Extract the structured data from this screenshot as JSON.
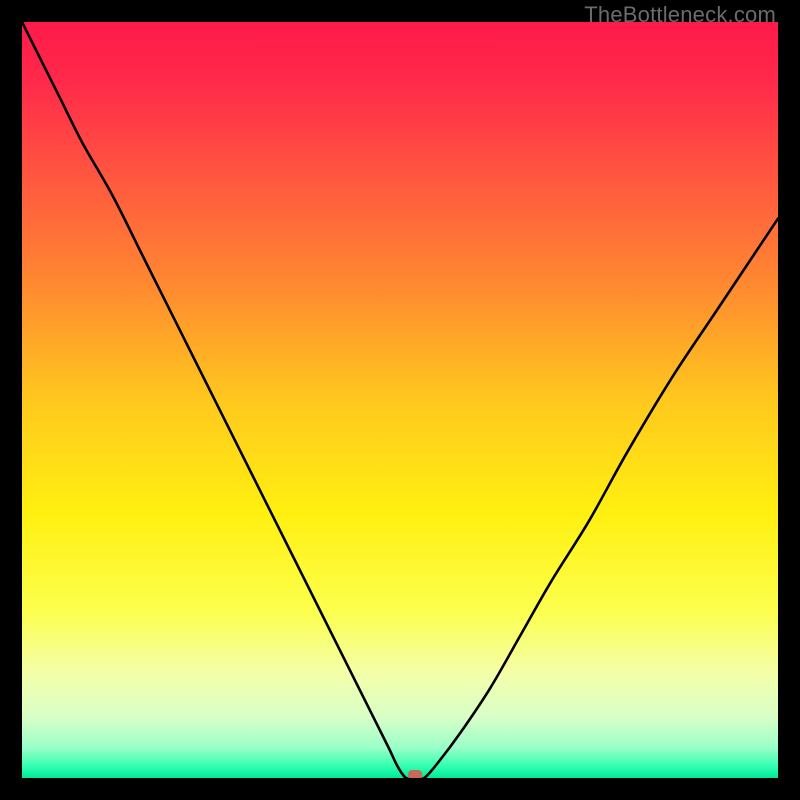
{
  "watermark": "TheBottleneck.com",
  "chart_data": {
    "type": "line",
    "title": "",
    "xlabel": "",
    "ylabel": "",
    "xlim": [
      0,
      100
    ],
    "ylim": [
      0,
      100
    ],
    "background": {
      "gradient_stops": [
        {
          "pos": 0.0,
          "color": "#ff1a4b"
        },
        {
          "pos": 0.08,
          "color": "#ff2a4a"
        },
        {
          "pos": 0.2,
          "color": "#ff5540"
        },
        {
          "pos": 0.35,
          "color": "#ff8a30"
        },
        {
          "pos": 0.5,
          "color": "#ffc81e"
        },
        {
          "pos": 0.65,
          "color": "#fff010"
        },
        {
          "pos": 0.78,
          "color": "#fcff4e"
        },
        {
          "pos": 0.86,
          "color": "#f4ffa8"
        },
        {
          "pos": 0.92,
          "color": "#d8ffc8"
        },
        {
          "pos": 0.96,
          "color": "#9affc8"
        },
        {
          "pos": 0.985,
          "color": "#30ffb0"
        },
        {
          "pos": 1.0,
          "color": "#00e89a"
        }
      ]
    },
    "curve": {
      "x": [
        0,
        2,
        5,
        8,
        12,
        16,
        20,
        24,
        28,
        32,
        36,
        40,
        43,
        45,
        47,
        48.5,
        49.7,
        50.8,
        52,
        53.2,
        55,
        58,
        62,
        66,
        70,
        75,
        80,
        86,
        92,
        100
      ],
      "y": [
        100,
        96,
        90,
        84,
        77,
        69,
        61,
        53,
        45,
        37,
        29,
        21,
        15,
        11,
        7,
        4,
        1.5,
        0,
        0,
        0,
        2,
        6,
        12,
        19,
        26,
        34,
        43,
        53,
        62,
        74
      ]
    },
    "marker": {
      "x": 52.0,
      "y": 0.4,
      "color": "#c46a5a"
    }
  }
}
